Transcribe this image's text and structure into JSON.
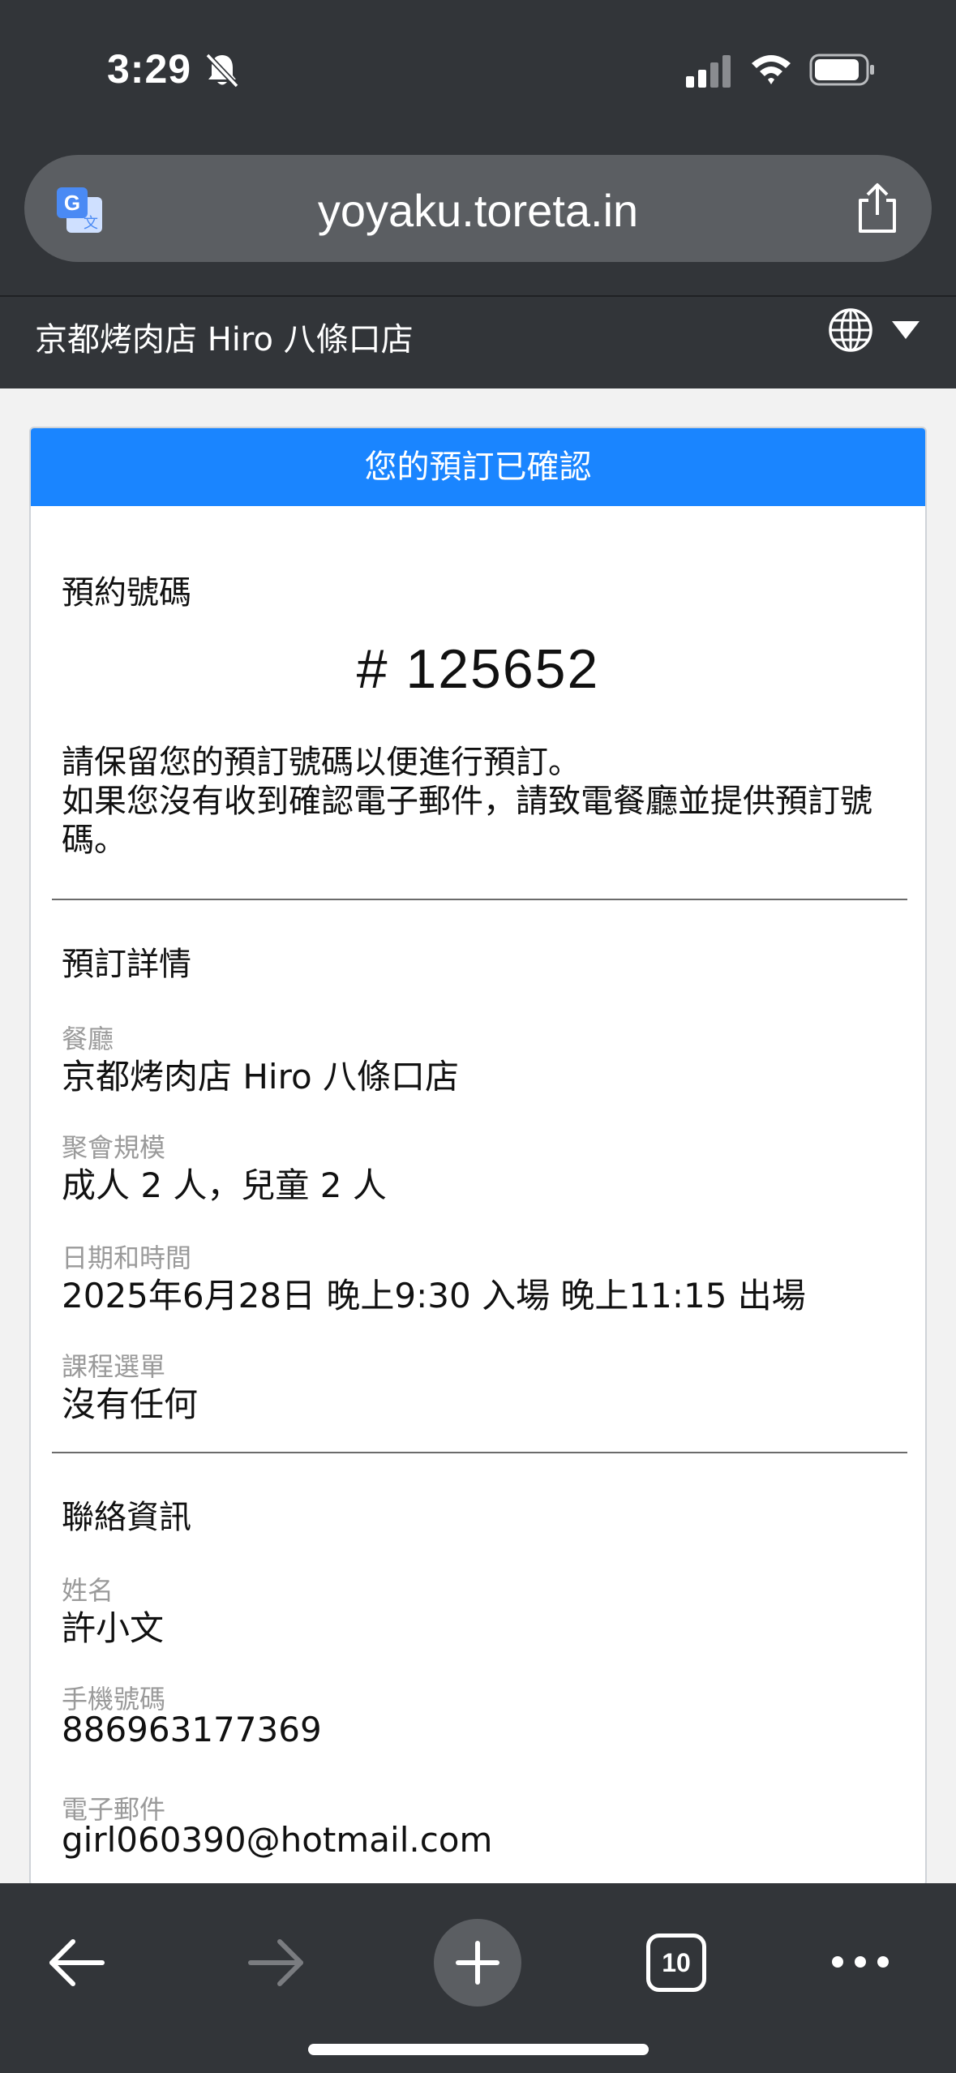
{
  "status_bar": {
    "time": "3:29",
    "icons": [
      "bell-slash-icon",
      "signal-icon",
      "wifi-icon",
      "battery-icon"
    ]
  },
  "browser": {
    "url": "yoyaku.toreta.in",
    "tab_count": "10",
    "icons": [
      "translate-icon",
      "share-icon",
      "back-icon",
      "forward-icon",
      "plus-icon",
      "tabs-icon",
      "more-icon"
    ]
  },
  "header": {
    "restaurant_name": "京都烤肉店 Hiro 八條口店",
    "icons": [
      "globe-icon",
      "caret-down-icon"
    ]
  },
  "card": {
    "title": "您的預訂已確認",
    "ref_heading": "預約號碼",
    "ref_number": "# 125652",
    "notice_line1": "請保留您的預訂號碼以便進行預訂。",
    "notice_line2": "如果您沒有收到確認電子郵件，請致電餐廳並提供預訂號碼。",
    "details": {
      "heading": "預訂詳情",
      "restaurant_label": "餐廳",
      "restaurant_value": "京都烤肉店 Hiro 八條口店",
      "party_label": "聚會規模",
      "party_value": "成人 2 人，兒童 2 人",
      "datetime_label": "日期和時間",
      "datetime_value": "2025年6月28日 晚上9:30 入場 晚上11:15 出場",
      "course_label": "課程選單",
      "course_value": "沒有任何"
    },
    "contact": {
      "heading": "聯絡資訊",
      "name_label": "姓名",
      "name_value": "許小文",
      "phone_label": "手機號碼",
      "phone_value": "886963177369",
      "email_label": "電子郵件",
      "email_value": "girl060390@hotmail.com"
    }
  },
  "colors": {
    "chrome": "#323539",
    "accent": "#1a85ff",
    "label_gray": "#9a9a9a"
  }
}
